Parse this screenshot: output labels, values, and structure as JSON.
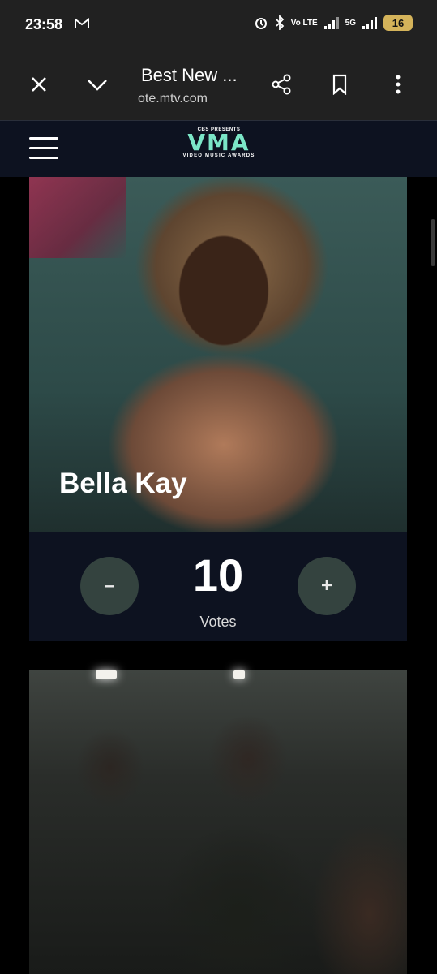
{
  "status": {
    "time": "23:58",
    "battery": "16",
    "network": "5G",
    "volte": "Vo LTE"
  },
  "browser": {
    "title": "Best New ...",
    "url": "ote.mtv.com"
  },
  "header": {
    "logo_top": "CBS PRESENTS",
    "logo_main": "VMA",
    "logo_sub": "VIDEO MUSIC AWARDS"
  },
  "nominees": [
    {
      "name": "Bella Kay",
      "votes": "10",
      "votes_label": "Votes",
      "minus": "–",
      "plus": "+"
    }
  ],
  "colors": {
    "accent": "#7be6c7",
    "panel": "#0d1220",
    "button": "#34433f"
  }
}
